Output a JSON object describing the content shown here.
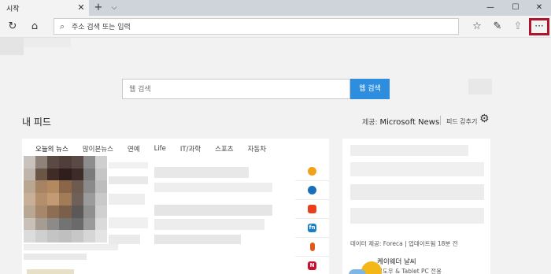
{
  "tab": {
    "title": "시작",
    "close": "✕"
  },
  "tabbar": {
    "new_tab": "+",
    "tab_menu": "⌵"
  },
  "window": {
    "minimize": "—",
    "maximize": "☐",
    "close": "✕"
  },
  "toolbar": {
    "refresh": "↻",
    "home": "⌂",
    "address_placeholder": "주소 검색 또는 입력",
    "favorites": "☆",
    "pen": "✎",
    "share": "⇪",
    "more": "···"
  },
  "search": {
    "placeholder": "웹 검색",
    "button": "웹 검색"
  },
  "feed": {
    "title": "내 피드",
    "provider_prefix": "제공:",
    "provider_name": "Microsoft News",
    "hide": "피드 감추기",
    "settings": "⚙",
    "categories": [
      "오늘의 뉴스",
      "많이본뉴스",
      "연예",
      "Life",
      "IT/과학",
      "스포츠",
      "자동차"
    ]
  },
  "channels": [
    {
      "label": "",
      "color": "#f0a21c"
    },
    {
      "label": "",
      "color": "#1a6fb8"
    },
    {
      "label": "",
      "color": "#e8401c"
    },
    {
      "label": "fn",
      "color": "#1a7fc4"
    },
    {
      "label": "",
      "color": "#e05a1a"
    },
    {
      "label": "N",
      "color": "#c8102e"
    }
  ],
  "weather": {
    "source": "데이터 제공: Foreca | 업데이트됨 18분 전",
    "title": "케이웨더 날씨",
    "subtitle": "윈도우 & Tablet PC 전용"
  }
}
